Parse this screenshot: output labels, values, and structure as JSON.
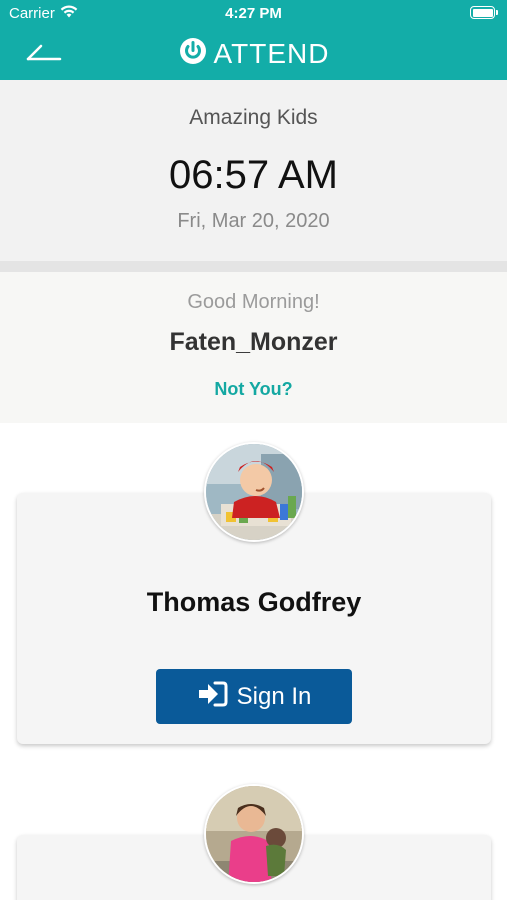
{
  "status_bar": {
    "carrier": "Carrier",
    "time": "4:27 PM"
  },
  "nav": {
    "logo_text": "ATTEND",
    "accent_color": "#13ada8"
  },
  "center": {
    "name": "Amazing Kids",
    "time": "06:57 AM",
    "date": "Fri, Mar  20, 2020"
  },
  "greeting": {
    "message": "Good Morning!",
    "user_name": "Faten_Monzer",
    "not_you_link": "Not You?"
  },
  "children": [
    {
      "name": "Thomas Godfrey",
      "action_label": "Sign In",
      "action_icon": "sign-in-icon",
      "avatar": "child-photo"
    },
    {
      "name": "",
      "avatar": "child-photo"
    }
  ],
  "colors": {
    "primary_button": "#0a5a99",
    "link": "#14a8a2"
  }
}
